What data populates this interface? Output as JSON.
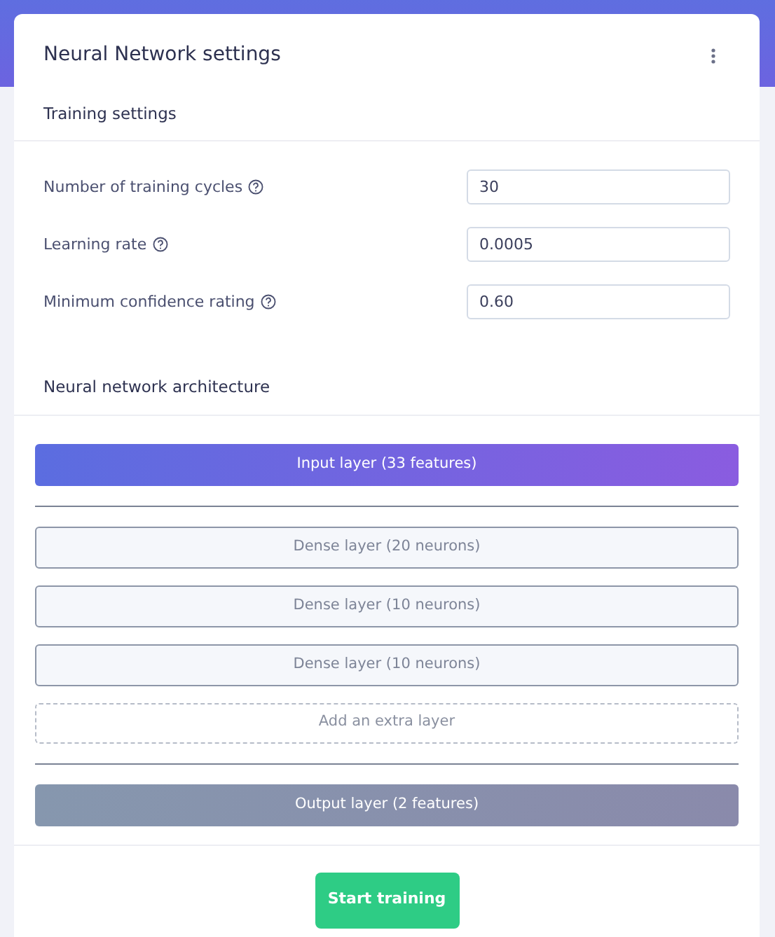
{
  "card": {
    "title": "Neural Network settings"
  },
  "training_settings": {
    "heading": "Training settings",
    "fields": [
      {
        "label": "Number of training cycles",
        "value": "30"
      },
      {
        "label": "Learning rate",
        "value": "0.0005"
      },
      {
        "label": "Minimum confidence rating",
        "value": "0.60"
      }
    ]
  },
  "architecture": {
    "heading": "Neural network architecture",
    "layers": [
      {
        "kind": "input",
        "label": "Input layer (33 features)"
      },
      {
        "kind": "dense",
        "label": "Dense layer (20 neurons)"
      },
      {
        "kind": "dense",
        "label": "Dense layer (10 neurons)"
      },
      {
        "kind": "dense",
        "label": "Dense layer (10 neurons)"
      },
      {
        "kind": "add",
        "label": "Add an extra layer"
      },
      {
        "kind": "output",
        "label": "Output layer (2 features)"
      }
    ]
  },
  "footer": {
    "button": "Start training"
  }
}
